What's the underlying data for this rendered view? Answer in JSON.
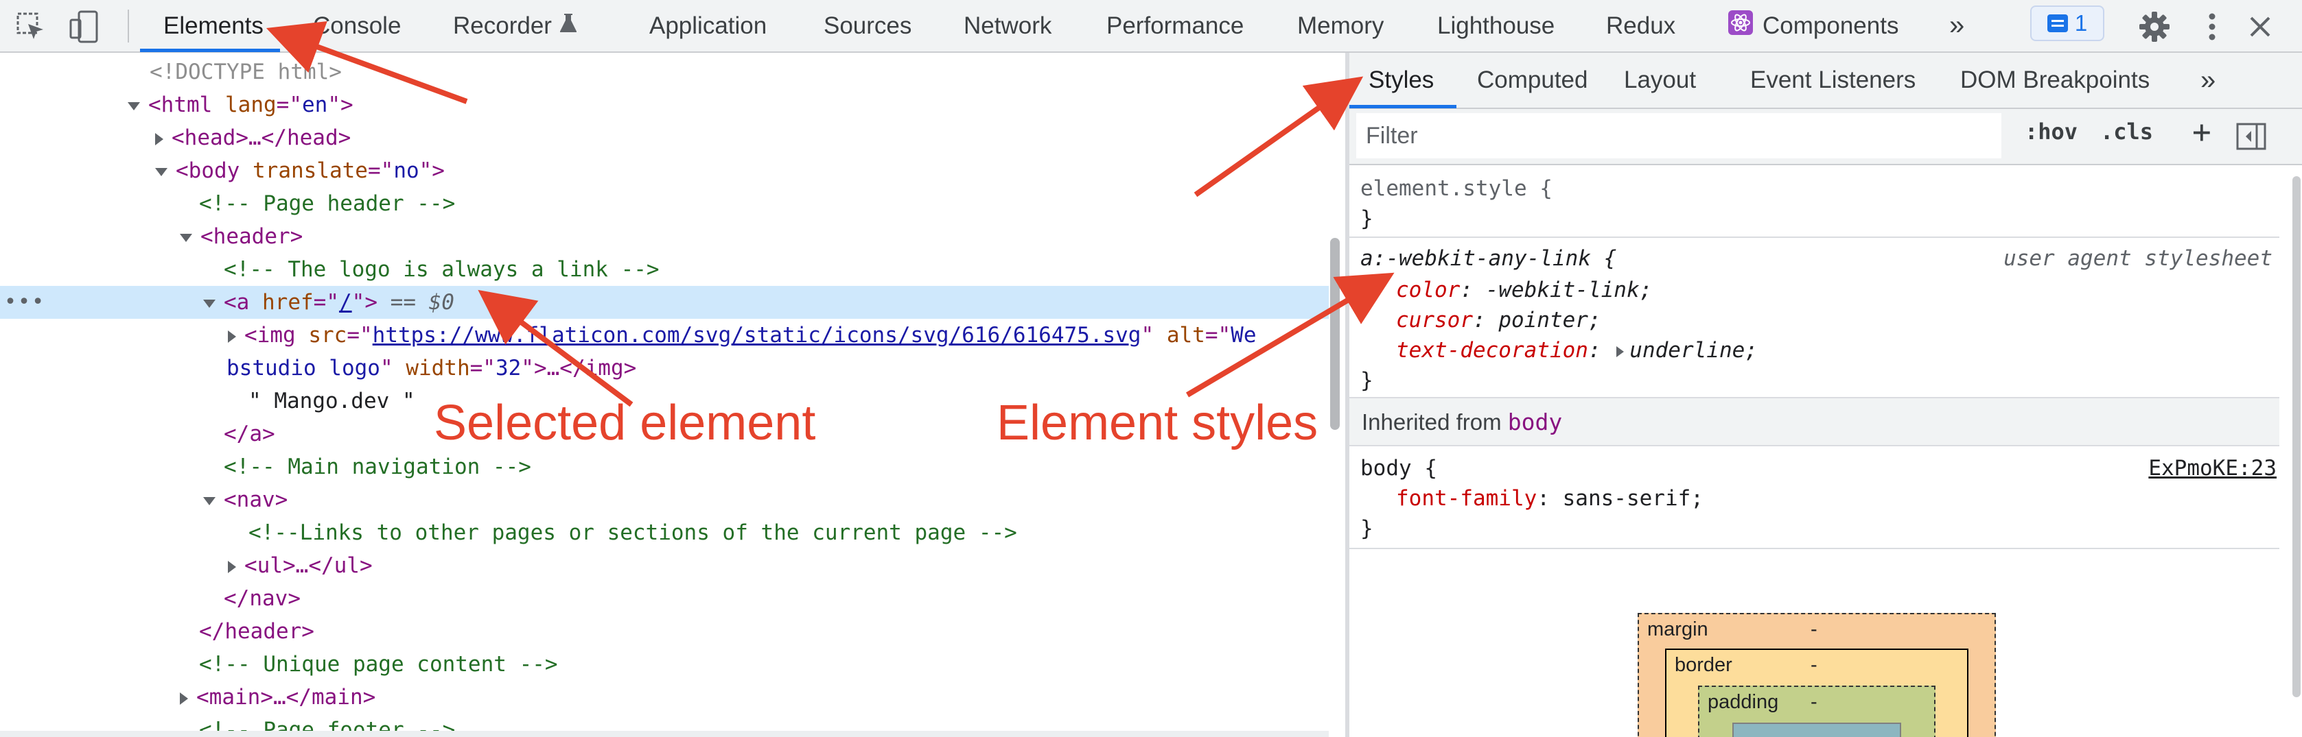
{
  "toolbar": {
    "tabs": [
      {
        "label": "Elements"
      },
      {
        "label": "Console"
      },
      {
        "label": "Recorder"
      },
      {
        "label": "Application"
      },
      {
        "label": "Sources"
      },
      {
        "label": "Network"
      },
      {
        "label": "Performance"
      },
      {
        "label": "Memory"
      },
      {
        "label": "Lighthouse"
      },
      {
        "label": "Redux"
      },
      {
        "label": "Components"
      }
    ],
    "active_tab": "Elements",
    "more_label": "»",
    "issues_count": "1",
    "icons": [
      "inspect-element-icon",
      "device-toolbar-icon",
      "recorder-flask-icon",
      "react-components-icon",
      "more-tabs-icon",
      "issues-icon",
      "settings-gear-icon",
      "kebab-menu-icon",
      "close-icon"
    ]
  },
  "dom": {
    "doctype": "<!DOCTYPE html>",
    "html_open_tag": "<html",
    "html_lang_attr": "lang",
    "html_lang_val": "en",
    "head_collapsed": "<head>…</head>",
    "body_open_tag": "<body",
    "body_attr": "translate",
    "body_attr_val": "no",
    "comment_header": "<!-- Page header -->",
    "header_open": "<header>",
    "comment_logo": "<!-- The logo is always a link -->",
    "a_open": "<a",
    "a_attr": "href",
    "a_attr_val": "/",
    "a_suffix": "== $0",
    "img_open": "<img",
    "img_src_attr": "src",
    "img_src_val": "https://www.flaticon.com/svg/static/icons/svg/616/616475.svg",
    "img_alt_attr": "alt",
    "img_alt_val_part1": "We",
    "img_alt_val_part2": "bstudio logo",
    "img_width_attr": "width",
    "img_width_val": "32",
    "img_close": ">…</img>",
    "text_node": "\" Mango.dev \"",
    "a_close": "</a>",
    "comment_nav": "<!-- Main navigation -->",
    "nav_open": "<nav>",
    "comment_links": "<!--Links to other pages or sections of the current page -->",
    "ul_collapsed": "<ul>…</ul>",
    "nav_close": "</nav>",
    "header_close": "</header>",
    "comment_unique": "<!-- Unique page content -->",
    "main_collapsed": "<main>…</main>",
    "comment_footer": "<!-- Page footer -->",
    "selected_ellipsis": "•••"
  },
  "annotations": {
    "selected_element": "Selected element",
    "element_styles": "Element styles",
    "arrow_color": "#e5432c"
  },
  "styles_panel": {
    "tabs": [
      {
        "label": "Styles"
      },
      {
        "label": "Computed"
      },
      {
        "label": "Layout"
      },
      {
        "label": "Event Listeners"
      },
      {
        "label": "DOM Breakpoints"
      }
    ],
    "active_tab": "Styles",
    "more_label": "»",
    "filter_placeholder": "Filter",
    "hov_label": ":hov",
    "cls_label": ".cls",
    "plus_label": "+",
    "rule_element_style": {
      "selector": "element.style {",
      "close": "}"
    },
    "rule_webkit": {
      "selector": "a:-webkit-any-link {",
      "source": "user agent stylesheet",
      "props": [
        {
          "name": "color",
          "value": "-webkit-link;"
        },
        {
          "name": "cursor",
          "value": "pointer;"
        },
        {
          "name": "text-decoration",
          "value": "underline;"
        }
      ],
      "close": "}"
    },
    "inherited_label": "Inherited from",
    "inherited_from": "body",
    "rule_body": {
      "selector": "body {",
      "source": "ExPmoKE:23",
      "props": [
        {
          "name": "font-family",
          "value": "sans-serif;"
        }
      ],
      "close": "}"
    },
    "box_model": {
      "margin_label": "margin",
      "margin_val": "-",
      "border_label": "border",
      "border_val": "-",
      "padding_label": "padding",
      "padding_val": "-"
    }
  },
  "colors": {
    "accent": "#1a73e8",
    "selected_row": "#cfe8fc",
    "tag": "#881280",
    "attr_name": "#994500",
    "attr_value": "#1a1aa6",
    "comment": "#236e25",
    "css_prop": "#c80000"
  }
}
